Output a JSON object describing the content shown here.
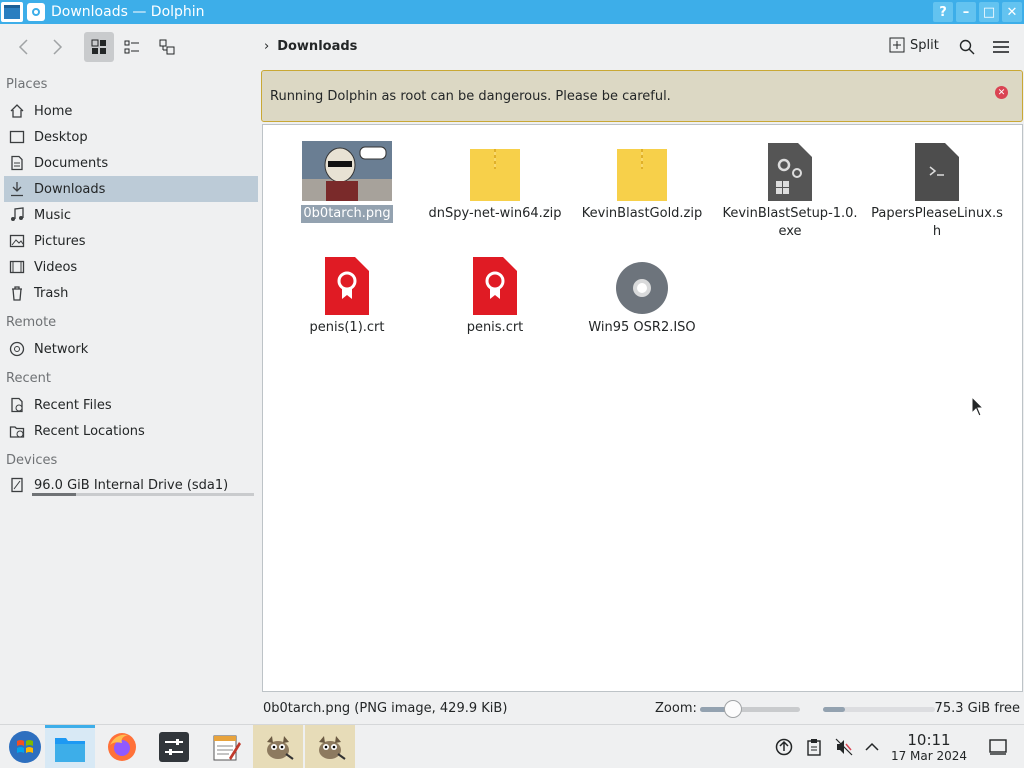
{
  "window": {
    "title": "Downloads — Dolphin",
    "buttons": {
      "help": "?",
      "minimize": "–",
      "maximize": "□",
      "close": "✕"
    }
  },
  "toolbar": {
    "breadcrumb": "Downloads",
    "split_label": "Split"
  },
  "sidebar": {
    "places_header": "Places",
    "remote_header": "Remote",
    "recent_header": "Recent",
    "devices_header": "Devices",
    "places": [
      {
        "label": "Home",
        "icon": "home-icon"
      },
      {
        "label": "Desktop",
        "icon": "desktop-icon"
      },
      {
        "label": "Documents",
        "icon": "documents-icon"
      },
      {
        "label": "Downloads",
        "icon": "downloads-icon",
        "selected": true
      },
      {
        "label": "Music",
        "icon": "music-icon"
      },
      {
        "label": "Pictures",
        "icon": "pictures-icon"
      },
      {
        "label": "Videos",
        "icon": "videos-icon"
      },
      {
        "label": "Trash",
        "icon": "trash-icon"
      }
    ],
    "remote": [
      {
        "label": "Network",
        "icon": "network-icon"
      }
    ],
    "recent": [
      {
        "label": "Recent Files",
        "icon": "recent-files-icon"
      },
      {
        "label": "Recent Locations",
        "icon": "recent-locations-icon"
      }
    ],
    "devices": [
      {
        "label": "96.0 GiB Internal Drive (sda1)",
        "icon": "drive-icon",
        "usage_fraction": 0.2
      }
    ]
  },
  "banner": {
    "message": "Running Dolphin as root can be dangerous. Please be careful."
  },
  "files": [
    {
      "name": "0b0tarch.png",
      "type": "image",
      "selected": true
    },
    {
      "name": "dnSpy-net-win64.zip",
      "type": "zip"
    },
    {
      "name": "KevinBlastGold.zip",
      "type": "zip"
    },
    {
      "name": "KevinBlastSetup-1.0.exe",
      "type": "exe"
    },
    {
      "name": "PapersPleaseLinux.sh",
      "type": "shell"
    },
    {
      "name": "penis(1).crt",
      "type": "certificate"
    },
    {
      "name": "penis.crt",
      "type": "certificate"
    },
    {
      "name": "Win95 OSR2.ISO",
      "type": "disc-image"
    }
  ],
  "statusbar": {
    "message": "0b0tarch.png (PNG image, 429.9 KiB)",
    "zoom_label": "Zoom:",
    "zoom_fraction": 0.33,
    "free_space": "75.3 GiB free",
    "used_fraction": 0.2
  },
  "taskbar": {
    "apps": [
      {
        "name": "start-menu",
        "icon": "windows-start-icon"
      },
      {
        "name": "dolphin",
        "icon": "folder-icon",
        "active": true
      },
      {
        "name": "firefox",
        "icon": "firefox-icon"
      },
      {
        "name": "system-settings",
        "icon": "settings-icon"
      },
      {
        "name": "text-editor",
        "icon": "notepad-icon"
      },
      {
        "name": "gimp-1",
        "icon": "gimp-icon",
        "open": true
      },
      {
        "name": "gimp-2",
        "icon": "gimp-icon",
        "open": true
      }
    ],
    "clock_time": "10:11",
    "clock_date": "17 Mar 2024"
  }
}
